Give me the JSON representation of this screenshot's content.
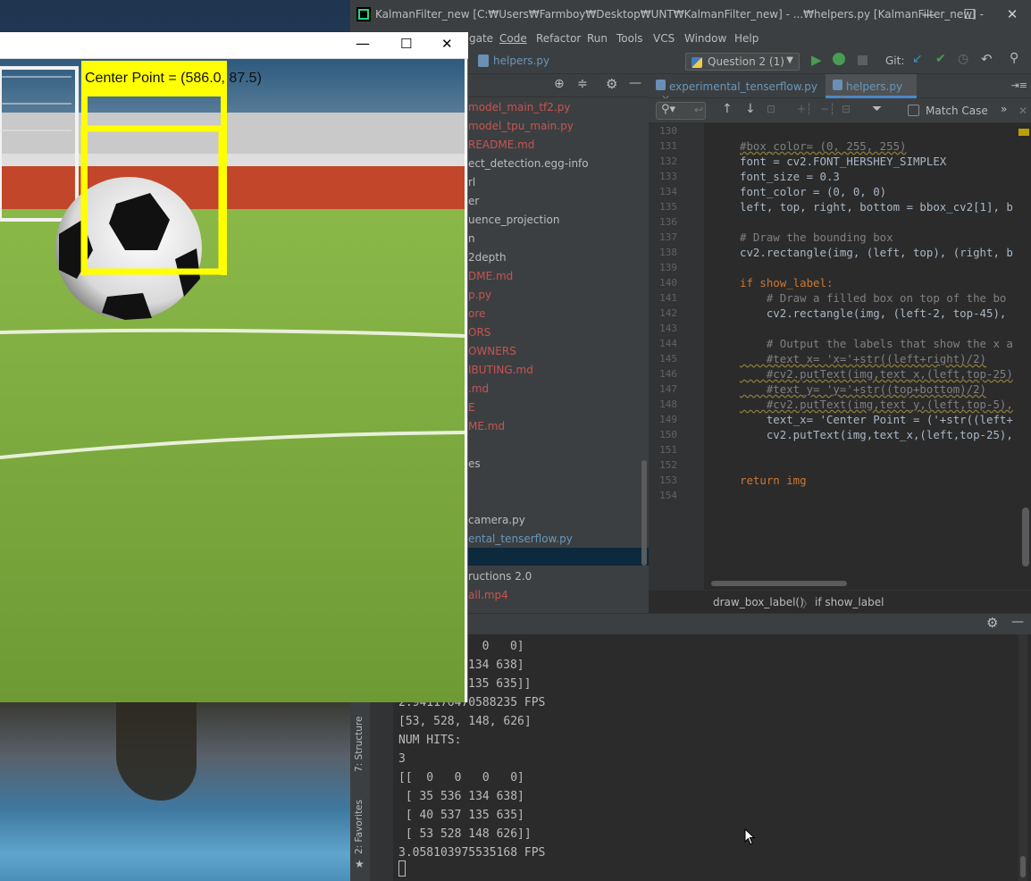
{
  "ide": {
    "window_title": "KalmanFilter_new [C:₩Users₩Farmboy₩Desktop₩UNT₩KalmanFilter_new] - ...₩helpers.py [KalmanFilter_new] -",
    "window_controls": {
      "minimize": "—",
      "maximize": "☐",
      "close": "✕"
    },
    "menu": [
      "gate",
      "Code",
      "Refactor",
      "Run",
      "Tools",
      "VCS",
      "Window",
      "Help"
    ],
    "toolbar": {
      "breadcrumb_file": "helpers.py",
      "run_config": "Question 2 (1)",
      "git_label": "Git:"
    },
    "project_items": [
      {
        "label": "model_main_tf2.py",
        "color": "#c75450"
      },
      {
        "label": "model_tpu_main.py",
        "color": "#c75450"
      },
      {
        "label": "README.md",
        "color": "#c75450"
      },
      {
        "label": "ect_detection.egg-info",
        "color": "#bbbbbb"
      },
      {
        "label": "rl",
        "color": "#bbbbbb"
      },
      {
        "label": "er",
        "color": "#bbbbbb"
      },
      {
        "label": "uence_projection",
        "color": "#bbbbbb"
      },
      {
        "label": "n",
        "color": "#bbbbbb"
      },
      {
        "label": "2depth",
        "color": "#bbbbbb"
      },
      {
        "label": "DME.md",
        "color": "#c75450"
      },
      {
        "label": "p.py",
        "color": "#c75450"
      },
      {
        "label": "ore",
        "color": "#c75450"
      },
      {
        "label": "ORS",
        "color": "#c75450"
      },
      {
        "label": "OWNERS",
        "color": "#c75450"
      },
      {
        "label": "IBUTING.md",
        "color": "#c75450"
      },
      {
        "label": ".md",
        "color": "#c75450"
      },
      {
        "label": "E",
        "color": "#c75450"
      },
      {
        "label": "ME.md",
        "color": "#c75450"
      },
      {
        "label": "",
        "color": "#bbbbbb"
      },
      {
        "label": "es",
        "color": "#bbbbbb"
      },
      {
        "label": "",
        "color": "#bbbbbb"
      },
      {
        "label": "",
        "color": "#bbbbbb"
      },
      {
        "label": "camera.py",
        "color": "#bbbbbb"
      },
      {
        "label": "ental_tenserflow.py",
        "color": "#6897bb"
      },
      {
        "label": "",
        "color": "#bbbbbb"
      },
      {
        "label": "ructions 2.0",
        "color": "#bbbbbb"
      },
      {
        "label": "all.mp4",
        "color": "#c75450"
      }
    ],
    "tabs": [
      {
        "label": "experimental_tenserflow.py",
        "active": false
      },
      {
        "label": "helpers.py",
        "active": true
      }
    ],
    "search": {
      "match_case_label": "Match Case"
    },
    "line_numbers": [
      "130",
      "131",
      "132",
      "133",
      "134",
      "135",
      "136",
      "137",
      "138",
      "139",
      "140",
      "141",
      "142",
      "143",
      "144",
      "145",
      "146",
      "147",
      "148",
      "149",
      "150",
      "151",
      "152",
      "153",
      "154"
    ],
    "code_lines": [
      "",
      "#box_color= (0, 255, 255)",
      "font = cv2.FONT_HERSHEY_SIMPLEX",
      "font_size = 0.3",
      "font_color = (0, 0, 0)",
      "left, top, right, bottom = bbox_cv2[1], b",
      "",
      "# Draw the bounding box",
      "cv2.rectangle(img, (left, top), (right, b",
      "",
      "if show_label:",
      "    # Draw a filled box on top of the bo",
      "    cv2.rectangle(img, (left-2, top-45),",
      "",
      "    # Output the labels that show the x a",
      "    #text_x= 'x='+str((left+right)/2)",
      "    #cv2.putText(img,text_x,(left,top-25)",
      "    #text_y= 'y='+str((top+bottom)/2)",
      "    #cv2.putText(img,text_y,(left,top-5),",
      "    text_x= 'Center Point = ('+str((left+",
      "    cv2.putText(img,text_x,(left,top-25),",
      "",
      "",
      "return img",
      ""
    ],
    "breadcrumbs": [
      "draw_box_label()",
      "if show_label"
    ],
    "console_lines": [
      "  0   0]",
      "134 638]",
      "135 635]]",
      "2.941176470588235 FPS",
      "[53, 528, 148, 626]",
      "NUM HITS:",
      "3",
      "[[  0   0   0   0]",
      " [ 35 536 134 638]",
      " [ 40 537 135 635]",
      " [ 53 528 148 626]]",
      "3.058103975535168 FPS"
    ],
    "side_tabs": {
      "structure": "7: Structure",
      "favorites": "2: Favorites"
    }
  },
  "cv_window": {
    "controls": {
      "minimize": "—",
      "maximize": "☐",
      "close": "✕"
    },
    "overlay_label": "Center Point = (586.0, 87.5)",
    "overlay_color": "#ffff00"
  },
  "colors": {
    "accent": "#21d789",
    "error": "#c75450",
    "link": "#6897bb"
  }
}
